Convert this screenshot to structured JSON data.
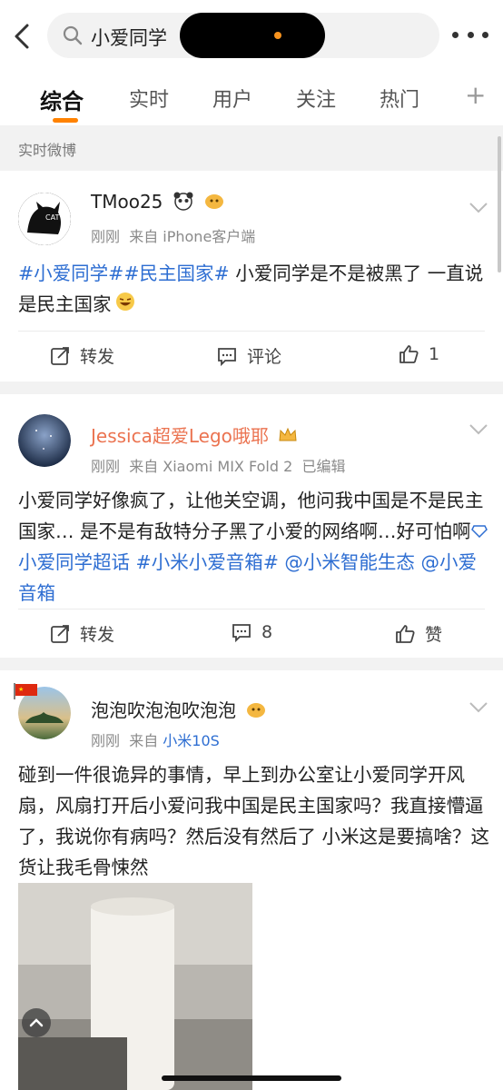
{
  "search": {
    "query": "小爱同学"
  },
  "tabs": [
    {
      "label": "综合"
    },
    {
      "label": "实时"
    },
    {
      "label": "用户"
    },
    {
      "label": "关注"
    },
    {
      "label": "热门"
    }
  ],
  "tab_plus": "+",
  "section": {
    "label": "实时微博"
  },
  "colors": {
    "accent": "#ff8200",
    "link": "#2e6ed2",
    "vip_name": "#eb7350"
  },
  "posts": [
    {
      "user": "TMoo25",
      "time": "刚刚",
      "source": "来自 iPhone客户端",
      "tag1": "#小爱同学#",
      "tag2": "#民主国家#",
      "text": " 小爱同学是不是被黑了 一直说是民主国家",
      "repost": "转发",
      "comment": "评论",
      "like": "1"
    },
    {
      "user": "Jessica超爱Lego哦耶",
      "time": "刚刚",
      "source": "来自 Xiaomi MIX Fold 2",
      "edited": "已编辑",
      "text": "小爱同学好像疯了，让他关空调，他问我中国是不是民主国家… 是不是有敌特分子黑了小爱的网络啊…好可怕啊",
      "super_topic": "小爱同学超话",
      "tag": "#小米小爱音箱#",
      "mention1": "@小米智能生态",
      "mention2": "@小爱音箱",
      "repost": "转发",
      "comment": "8",
      "like": "赞"
    },
    {
      "user": "泡泡吹泡泡吹泡泡",
      "time": "刚刚",
      "source": "来自",
      "device": "小米10S",
      "text": "碰到一件很诡异的事情，早上到办公室让小爱同学开风扇，风扇打开后小爱问我中国是民主国家吗？我直接懵逼了，我说你有病吗？然后没有然后了 小米这是要搞啥？这货让我毛骨悚然"
    }
  ]
}
